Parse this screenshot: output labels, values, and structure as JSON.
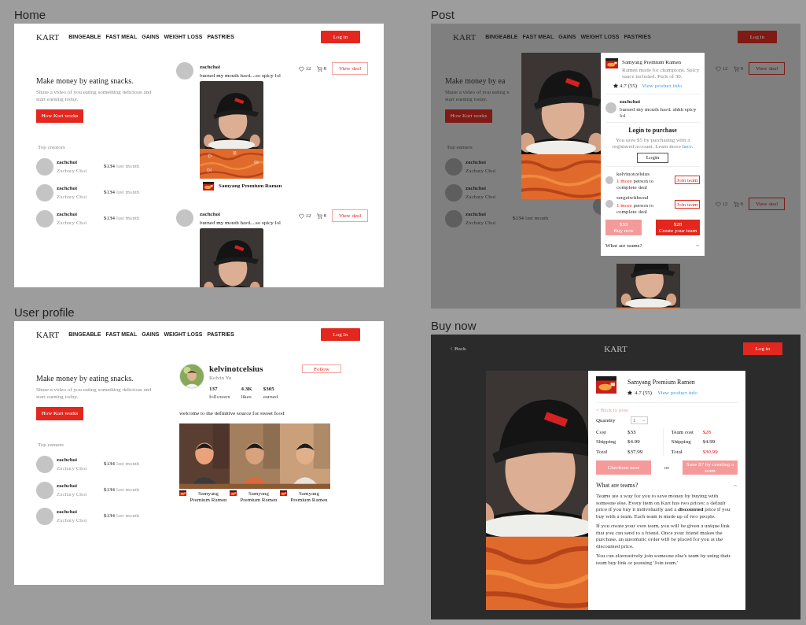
{
  "home": {
    "label": "Home",
    "nav": {
      "logo": "KART",
      "links": [
        "BINGEABLE",
        "FAST MEAL",
        "GAINS",
        "WEIGHT LOSS",
        "PASTRIES"
      ],
      "login": "Log in"
    },
    "hero": {
      "title": "Make money by eating snacks.",
      "subtitle_lines": [
        "Share a video of you eating something delicious and",
        "start earning today."
      ],
      "button": "How Kart works"
    },
    "earners": {
      "heading": "Top creators",
      "rows": [
        {
          "username": "zachchoi",
          "name": "Zachary Choi",
          "amount": "$134",
          "period": "last month"
        },
        {
          "username": "zachchoi",
          "name": "Zachary Choi",
          "amount": "$134",
          "period": "last month"
        },
        {
          "username": "zachchoi",
          "name": "Zachary Choi",
          "amount": "$134",
          "period": "last month"
        }
      ]
    },
    "posts": [
      {
        "username": "zachchoi",
        "caption": "burned my mouth hard....so spicy lol",
        "likes": "12",
        "carts": "8",
        "button": "View deal",
        "product": "Samyang Premium Ramen"
      },
      {
        "username": "zachchoi",
        "caption": "burned my mouth hard....so spicy lol",
        "likes": "12",
        "carts": "8",
        "button": "View deal"
      }
    ]
  },
  "post": {
    "label": "Post",
    "nav": {
      "logo": "KART",
      "links": [
        "BINGEABLE",
        "FAST MEAL",
        "GAINS",
        "WEIGHT LOSS",
        "PASTRIES"
      ],
      "login": "Log in"
    },
    "hero": {
      "title": "Make money by ea",
      "subtitle_lines": [
        "Share a video of you eating s",
        "start earning today."
      ],
      "button": "How Kart works"
    },
    "earners": {
      "heading": "Top earners",
      "rows": [
        {
          "username": "zachchoi",
          "name": "Zachary Choi"
        },
        {
          "username": "zachchoi",
          "name": "Zachary Choi"
        },
        {
          "username": "zachchoi",
          "name": "Zachary Choi",
          "amount": "$134",
          "period": "last month"
        }
      ]
    },
    "posts": [
      {
        "likes": "12",
        "carts": "8",
        "button": "View deal"
      },
      {
        "likes": "12",
        "carts": "8",
        "button": "View deal"
      }
    ],
    "modal": {
      "product": {
        "name": "Samyang Premium Ramen",
        "description": "Ramen made for champions. Spicy sauce included. Pack of 30.",
        "rating": "4.7 (55)",
        "link": "View product info"
      },
      "post": {
        "username": "zachchoi",
        "caption": "burned my mouth hard. ahhh spicy lol"
      },
      "login": {
        "title": "Login to purchase",
        "text": "You save $5 by purchasing with a registered account. Learn more",
        "link": "here.",
        "button": "Login"
      },
      "teams": [
        {
          "username": "kelvinotcelsius",
          "needed": "1 more",
          "text": "person to complete deal",
          "button": "Join team"
        },
        {
          "username": "sergeiwithsoul",
          "needed": "1 more",
          "text": "person to complete deal",
          "button": "Join team"
        }
      ],
      "actions": [
        {
          "kind": "light",
          "price": "$33",
          "label": "Buy now"
        },
        {
          "kind": "solid",
          "price": "$28",
          "label": "Create your team"
        }
      ],
      "faq": {
        "question": "What are teams?",
        "expanded": false
      }
    }
  },
  "user_profile": {
    "label": "User profile",
    "nav": {
      "logo": "KART",
      "links": [
        "BINGEABLE",
        "FAST MEAL",
        "GAINS",
        "WEIGHT LOSS",
        "PASTRIES"
      ],
      "login": "Log In"
    },
    "hero": {
      "title": "Make money by eating snacks.",
      "subtitle_lines": [
        "Share a video of you eating something delicious and",
        "start earning today."
      ],
      "button": "How Kart works"
    },
    "earners": {
      "heading": "Top earners",
      "rows": [
        {
          "username": "zachchoi",
          "name": "Zachary Choi",
          "amount": "$134",
          "period": "last month"
        },
        {
          "username": "zachchoi",
          "name": "Zachary Choi",
          "amount": "$134",
          "period": "last month"
        },
        {
          "username": "zachchoi",
          "name": "Zachary Choi",
          "amount": "$134",
          "period": "last month"
        }
      ]
    },
    "profile": {
      "username": "kelvinotcelsius",
      "name": "Kelvin Yu",
      "button": "Follow",
      "stats": [
        {
          "value": "137",
          "label": "followers"
        },
        {
          "value": "4.3K",
          "label": "likes"
        },
        {
          "value": "$305",
          "label": "earned"
        }
      ],
      "bio": "welcome to the definitive source for sweet food",
      "videos": [
        {
          "product": "Samyang Premium Ramen"
        },
        {
          "product": "Samyang Premium Ramen"
        },
        {
          "product": "Samyang Premium Ramen"
        }
      ]
    }
  },
  "buy_now": {
    "label": "Buy now",
    "header": {
      "back": "Back",
      "logo": "KART",
      "login": "Log in"
    },
    "product": {
      "name": "Samyang Premium Ramen",
      "rating": "4.7 (55)",
      "link": "View product info"
    },
    "back_link": "< Back to post",
    "quantity": {
      "label": "Quantity",
      "value": "1"
    },
    "prices": [
      {
        "kind": "solo",
        "rows": [
          {
            "label": "Cost",
            "value": "$33",
            "highlight": false
          },
          {
            "label": "Shipping",
            "value": "$4.99",
            "highlight": false
          },
          {
            "label": "Total",
            "value": "$37.99",
            "highlight": false
          }
        ]
      },
      {
        "kind": "team",
        "rows": [
          {
            "label": "Team cost",
            "value": "$28",
            "highlight": true
          },
          {
            "label": "Shipping",
            "value": "$4.99",
            "highlight": false
          },
          {
            "label": "Total",
            "value": "$30.99",
            "highlight": true
          }
        ]
      }
    ],
    "actions": [
      {
        "label": "Checkout now"
      },
      {
        "label": "Save $7 by creating a team"
      }
    ],
    "or": "or",
    "faq": {
      "question": "What are teams?",
      "expanded": true,
      "paragraphs": [
        "Teams are a way for you to save money by buying with someone else. Every item on Kart has two prices: a default price if you buy it individually and a **discounted** price if you buy with a team.  Each team is made up of two people.",
        "If you create your own team, you will be given a unique link that you can send to a friend. Once your friend makes the purchase, an automatic order will be placed for you at the discounted price.",
        "You can alternatively join someone else's team by using their team buy link or pressing 'Join team.'"
      ]
    }
  }
}
